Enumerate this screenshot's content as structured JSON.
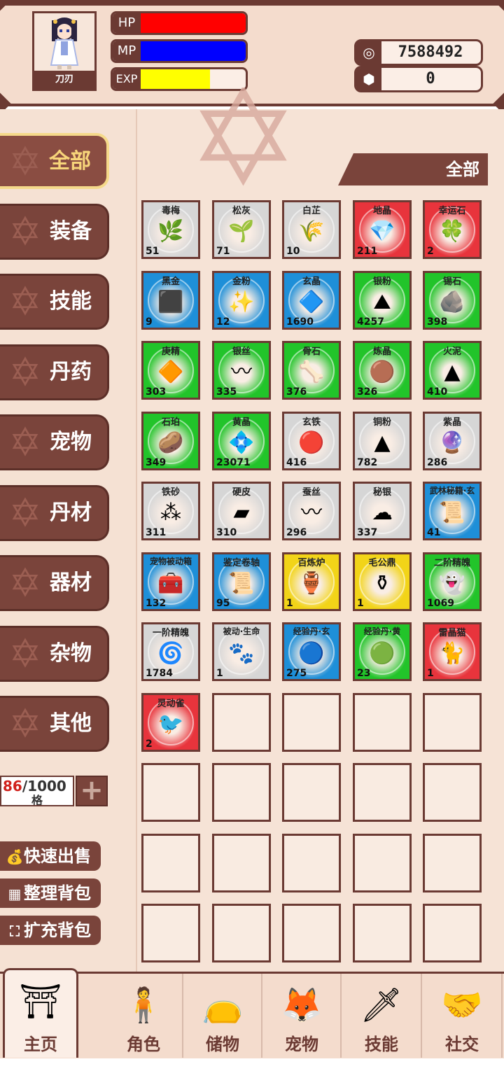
{
  "player": {
    "name": "刀刃"
  },
  "stats": {
    "hp": {
      "label": "HP",
      "fill": 1.0,
      "color": "#ff0000"
    },
    "mp": {
      "label": "MP",
      "fill": 1.0,
      "color": "#0000ff"
    },
    "exp": {
      "label": "EXP",
      "fill": 0.66,
      "color": "#ffff00"
    }
  },
  "currency": {
    "coins": {
      "icon": "coin-icon",
      "value": "7588492"
    },
    "gems": {
      "icon": "gem-icon",
      "value": "0"
    }
  },
  "categories": [
    {
      "label": "全部",
      "active": true
    },
    {
      "label": "装备"
    },
    {
      "label": "技能"
    },
    {
      "label": "丹药"
    },
    {
      "label": "宠物"
    },
    {
      "label": "丹材"
    },
    {
      "label": "器材"
    },
    {
      "label": "杂物"
    },
    {
      "label": "其他"
    }
  ],
  "filter": {
    "label": "全部"
  },
  "capacity": {
    "used": "86",
    "total": "/1000",
    "unit": "格"
  },
  "actions": [
    {
      "label": "快速出售",
      "icon": "money-bag-icon"
    },
    {
      "label": "整理背包",
      "icon": "grid-icon"
    },
    {
      "label": "扩充背包",
      "icon": "expand-icon"
    }
  ],
  "items": [
    {
      "name": "毒梅",
      "count": "51",
      "rarity": "grey",
      "icon": "herb-icon",
      "glyph": "🌿"
    },
    {
      "name": "松灰",
      "count": "71",
      "rarity": "grey",
      "icon": "moss-icon",
      "glyph": "🌱"
    },
    {
      "name": "白芷",
      "count": "10",
      "rarity": "grey",
      "icon": "herb-icon",
      "glyph": "🌾"
    },
    {
      "name": "地晶",
      "count": "211",
      "rarity": "red",
      "icon": "crystal-icon",
      "glyph": "💎"
    },
    {
      "name": "幸运石",
      "count": "2",
      "rarity": "red",
      "icon": "lucky-stone-icon",
      "glyph": "🍀"
    },
    {
      "name": "黑金",
      "count": "9",
      "rarity": "blue",
      "icon": "ore-icon",
      "glyph": "⬛"
    },
    {
      "name": "金粉",
      "count": "12",
      "rarity": "blue",
      "icon": "powder-icon",
      "glyph": "✨"
    },
    {
      "name": "玄晶",
      "count": "1690",
      "rarity": "blue",
      "icon": "crystal-icon",
      "glyph": "🔷"
    },
    {
      "name": "银粉",
      "count": "4257",
      "rarity": "green",
      "icon": "powder-icon",
      "glyph": "⛰"
    },
    {
      "name": "锡石",
      "count": "398",
      "rarity": "green",
      "icon": "stone-icon",
      "glyph": "🪨"
    },
    {
      "name": "庚精",
      "count": "303",
      "rarity": "green",
      "icon": "powder-icon",
      "glyph": "🔶"
    },
    {
      "name": "银丝",
      "count": "335",
      "rarity": "green",
      "icon": "thread-icon",
      "glyph": "〰"
    },
    {
      "name": "骨石",
      "count": "376",
      "rarity": "green",
      "icon": "bone-icon",
      "glyph": "🦴"
    },
    {
      "name": "炼晶",
      "count": "326",
      "rarity": "green",
      "icon": "ore-icon",
      "glyph": "🟤"
    },
    {
      "name": "火泥",
      "count": "410",
      "rarity": "green",
      "icon": "powder-icon",
      "glyph": "▲"
    },
    {
      "name": "石珀",
      "count": "349",
      "rarity": "green",
      "icon": "amber-icon",
      "glyph": "🥔"
    },
    {
      "name": "黄晶",
      "count": "23071",
      "rarity": "green",
      "icon": "crystal-icon",
      "glyph": "💠"
    },
    {
      "name": "玄铁",
      "count": "416",
      "rarity": "grey",
      "icon": "ore-icon",
      "glyph": "🔴"
    },
    {
      "name": "铜粉",
      "count": "782",
      "rarity": "grey",
      "icon": "powder-icon",
      "glyph": "▲"
    },
    {
      "name": "紫晶",
      "count": "286",
      "rarity": "grey",
      "icon": "crystal-icon",
      "glyph": "🔮"
    },
    {
      "name": "铁砂",
      "count": "311",
      "rarity": "grey",
      "icon": "sand-icon",
      "glyph": "⁂"
    },
    {
      "name": "硬皮",
      "count": "310",
      "rarity": "grey",
      "icon": "hide-icon",
      "glyph": "▰"
    },
    {
      "name": "蚕丝",
      "count": "296",
      "rarity": "grey",
      "icon": "thread-icon",
      "glyph": "〰"
    },
    {
      "name": "秘银",
      "count": "337",
      "rarity": "grey",
      "icon": "cloud-icon",
      "glyph": "☁"
    },
    {
      "name": "武林秘籍·玄",
      "count": "41",
      "rarity": "blue",
      "icon": "scroll-icon",
      "glyph": "📜"
    },
    {
      "name": "宠物被动箱",
      "count": "132",
      "rarity": "blue",
      "icon": "chest-icon",
      "glyph": "🧰"
    },
    {
      "name": "鉴定卷轴",
      "count": "95",
      "rarity": "blue",
      "icon": "scroll-icon",
      "glyph": "📜"
    },
    {
      "name": "百炼炉",
      "count": "1",
      "rarity": "yellow",
      "icon": "furnace-icon",
      "glyph": "🏺"
    },
    {
      "name": "毛公鼎",
      "count": "1",
      "rarity": "yellow",
      "icon": "cauldron-icon",
      "glyph": "⚱"
    },
    {
      "name": "二阶精魄",
      "count": "1069",
      "rarity": "green",
      "icon": "spirit-icon",
      "glyph": "👻"
    },
    {
      "name": "一阶精魄",
      "count": "1784",
      "rarity": "grey",
      "icon": "spirit-icon",
      "glyph": "🌀"
    },
    {
      "name": "被动·生命",
      "count": "1",
      "rarity": "grey",
      "icon": "scroll-icon",
      "glyph": "🐾"
    },
    {
      "name": "经验丹·玄",
      "count": "275",
      "rarity": "blue",
      "icon": "pill-icon",
      "glyph": "🔵"
    },
    {
      "name": "经验丹·黄",
      "count": "23",
      "rarity": "green",
      "icon": "pill-icon",
      "glyph": "🟢"
    },
    {
      "name": "雷晶猫",
      "count": "1",
      "rarity": "red",
      "icon": "cat-icon",
      "glyph": "🐈"
    },
    {
      "name": "灵动雀",
      "count": "2",
      "rarity": "red",
      "icon": "bird-icon",
      "glyph": "🐦"
    }
  ],
  "total_slots": 55,
  "rarity_colors": {
    "grey": "#d6d6d6",
    "blue": "#1e8fd8",
    "green": "#22c42a",
    "red": "#e8343c",
    "yellow": "#f2d418"
  },
  "nav": [
    {
      "label": "主页",
      "icon": "gate-icon",
      "glyph": "⛩",
      "active": true
    },
    {
      "label": "角色",
      "icon": "character-icon",
      "glyph": "🧍"
    },
    {
      "label": "储物",
      "icon": "bag-icon",
      "glyph": "👝"
    },
    {
      "label": "宠物",
      "icon": "fox-icon",
      "glyph": "🦊"
    },
    {
      "label": "技能",
      "icon": "sword-icon",
      "glyph": "🗡"
    },
    {
      "label": "社交",
      "icon": "handshake-icon",
      "glyph": "🤝"
    }
  ]
}
